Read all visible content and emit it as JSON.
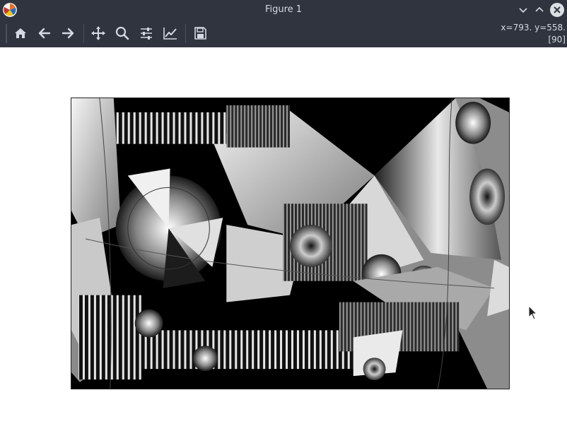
{
  "window": {
    "title": "Figure 1"
  },
  "toolbar": {
    "buttons": [
      {
        "name": "home",
        "icon": "home-icon"
      },
      {
        "name": "back",
        "icon": "arrow-left-icon"
      },
      {
        "name": "forward",
        "icon": "arrow-right-icon"
      },
      {
        "name": "pan",
        "icon": "move-icon"
      },
      {
        "name": "zoom",
        "icon": "magnifier-icon"
      },
      {
        "name": "subplots",
        "icon": "sliders-icon"
      },
      {
        "name": "customize",
        "icon": "line-chart-icon"
      },
      {
        "name": "save",
        "icon": "floppy-disk-icon"
      }
    ],
    "coords_line1": "x=793. y=558.",
    "coords_line2": "[90]"
  },
  "colors": {
    "chrome": "#2f343f",
    "chrome_text": "#d3dae3",
    "icon": "#d3dae3",
    "figure_bg": "#ffffff"
  }
}
